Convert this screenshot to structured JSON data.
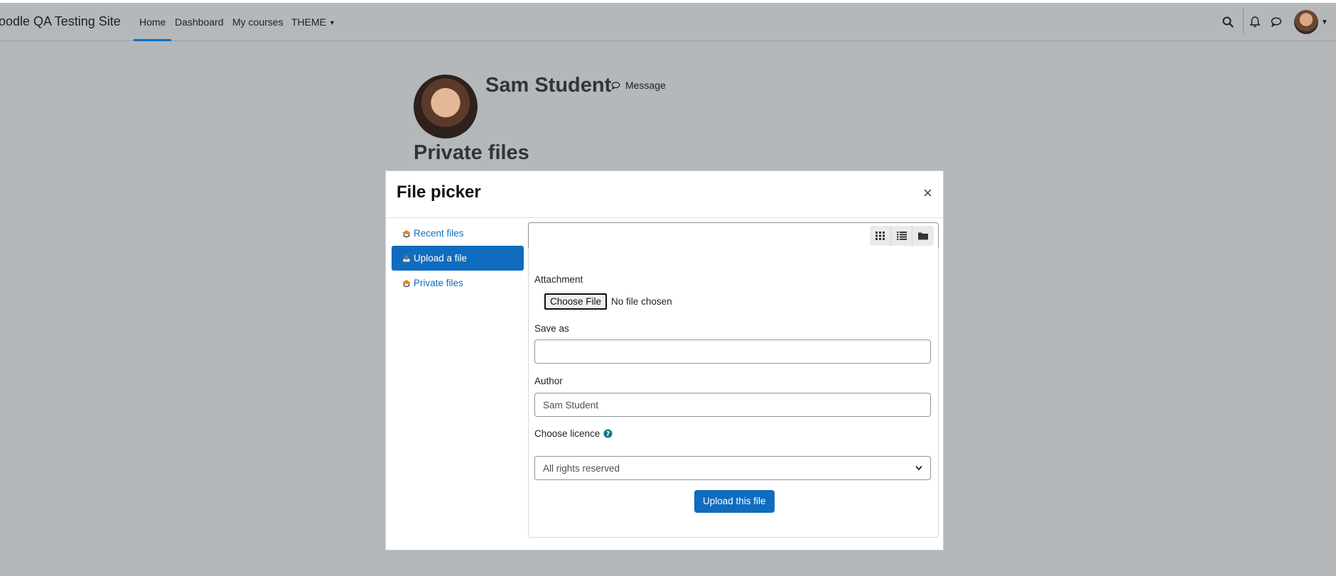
{
  "navbar": {
    "brand": "loodle QA Testing Site",
    "items": [
      {
        "label": "Home",
        "active": true
      },
      {
        "label": "Dashboard",
        "active": false
      },
      {
        "label": "My courses",
        "active": false
      },
      {
        "label": "THEME",
        "active": false
      }
    ],
    "icons": [
      "search-icon",
      "bell-icon",
      "chat-icon",
      "user-avatar"
    ]
  },
  "profile": {
    "name": "Sam Student",
    "message_label": "Message"
  },
  "page": {
    "heading": "Private files"
  },
  "file_picker": {
    "title": "File picker",
    "close_symbol": "×",
    "repositories": [
      {
        "label": "Recent files",
        "active": false
      },
      {
        "label": "Upload a file",
        "active": true
      },
      {
        "label": "Private files",
        "active": false
      }
    ],
    "view_modes": [
      "icons-view",
      "list-view",
      "folder-view"
    ],
    "form": {
      "attachment_label": "Attachment",
      "choose_file_label": "Choose File",
      "no_file_text": "No file chosen",
      "save_as_label": "Save as",
      "save_as_value": "",
      "author_label": "Author",
      "author_value": "Sam Student",
      "licence_label": "Choose licence",
      "licence_value": "All rights reserved",
      "upload_button": "Upload this file"
    }
  },
  "colors": {
    "primary": "#0f6cbf",
    "overlay_bg": "#b4b8bb",
    "help_icon": "#0f7a8c"
  }
}
